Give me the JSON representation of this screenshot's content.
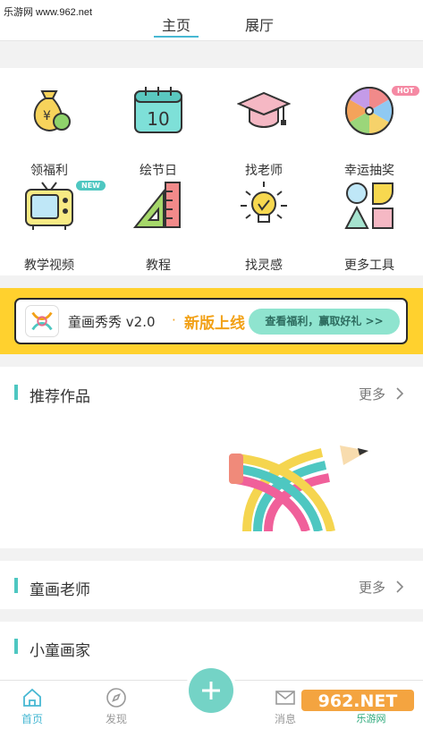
{
  "watermark_top": "乐游网 www.962.net",
  "header": {
    "tabs": [
      "主页",
      "展厅"
    ]
  },
  "grid": [
    {
      "label": "领福利",
      "icon": "money-bag-icon"
    },
    {
      "label": "绘节日",
      "icon": "calendar-icon",
      "icon_text": "10"
    },
    {
      "label": "找老师",
      "icon": "graduation-cap-icon"
    },
    {
      "label": "幸运抽奖",
      "icon": "lucky-wheel-icon",
      "badge": "HOT"
    },
    {
      "label": "教学视频",
      "icon": "tv-icon",
      "badge": "NEW"
    },
    {
      "label": "教程",
      "icon": "ruler-icon"
    },
    {
      "label": "找灵感",
      "icon": "lightbulb-icon"
    },
    {
      "label": "更多工具",
      "icon": "shapes-icon"
    }
  ],
  "banner": {
    "app_name": "童画秀秀 v2.0",
    "dot": "·",
    "headline": "新版上线",
    "button": "查看福利，赢取好礼 >>"
  },
  "sections": [
    {
      "title": "推荐作品",
      "more": "更多"
    },
    {
      "title": "童画老师",
      "more": "更多"
    },
    {
      "title": "小童画家"
    }
  ],
  "tabbar": [
    {
      "label": "首页",
      "icon": "home-icon",
      "active": true
    },
    {
      "label": "发现",
      "icon": "compass-icon"
    },
    {
      "label": "消息",
      "icon": "mail-icon"
    }
  ],
  "watermark_bottom": {
    "brand": "962.NET",
    "sub": "乐游网"
  },
  "colors": {
    "accent": "#47b8d3",
    "teal": "#4ec7c1",
    "banner_yellow": "#ffd12e",
    "headline_orange": "#f2a117"
  }
}
